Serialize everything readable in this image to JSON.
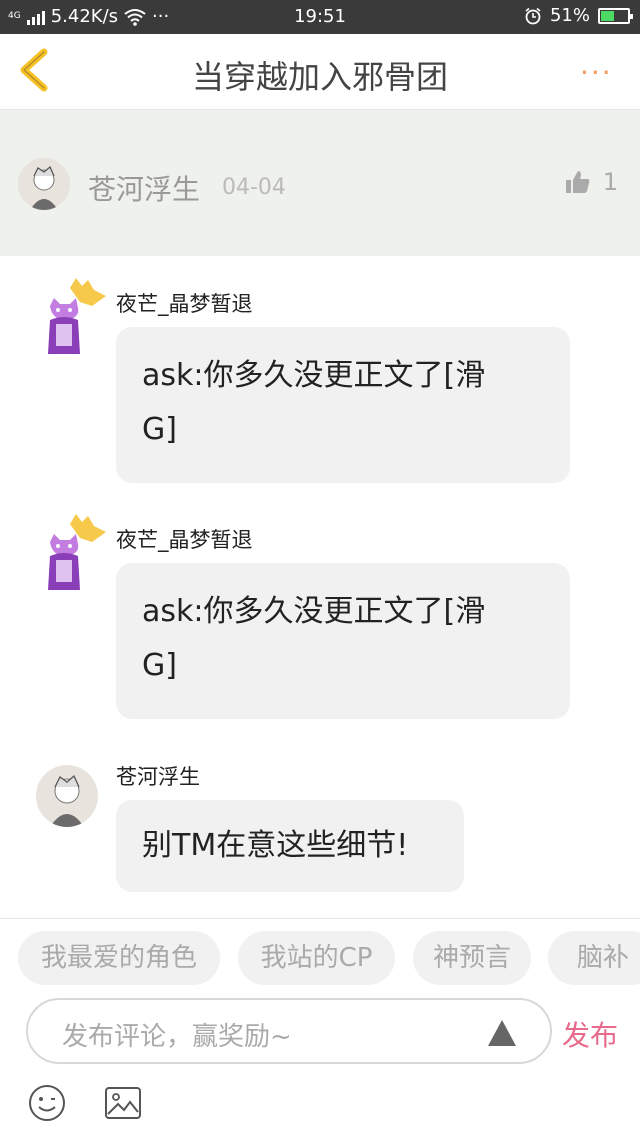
{
  "status_bar": {
    "network": "4G",
    "speed": "5.42K/s",
    "more": "···",
    "time": "19:51",
    "battery": "51%",
    "battery_level": 0.51
  },
  "header": {
    "title": "当穿越加入邪骨团",
    "more_label": "···"
  },
  "topic": {
    "author": "苍河浮生",
    "date": "04-04",
    "likes": "1"
  },
  "messages": [
    {
      "name": "夜芒_晶梦暂退",
      "line1": "ask:你多久没更正文了[滑",
      "line2": "G]"
    },
    {
      "name": "夜芒_晶梦暂退",
      "line1": "ask:你多久没更正文了[滑",
      "line2": "G]"
    },
    {
      "name": "苍河浮生",
      "line1": "别TM在意这些细节!"
    }
  ],
  "tags": [
    "我最爱的角色",
    "我站的CP",
    "神预言",
    "脑补"
  ],
  "comment": {
    "placeholder": "发布评论，赢奖励~",
    "publish_label": "发布"
  },
  "colors": {
    "accent_pink": "#e86a8a",
    "accent_orange": "#f39a5c",
    "back_yellow": "#f6c026",
    "topic_bg": "#eff1ec",
    "bubble_bg": "#f1f1f1"
  }
}
